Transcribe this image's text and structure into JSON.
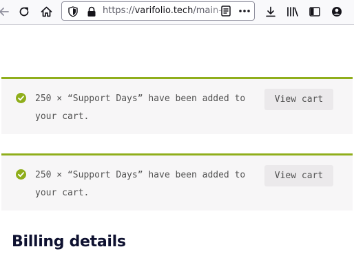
{
  "browser": {
    "url_scheme": "https://",
    "url_host": "varifolio.tech",
    "url_path": "/main-"
  },
  "notices": [
    {
      "message": "250 × “Support Days” have been added to your cart.",
      "button_label": "View cart"
    },
    {
      "message": "250 × “Support Days” have been added to your cart.",
      "button_label": "View cart"
    }
  ],
  "billing": {
    "title": "Billing details"
  },
  "colors": {
    "success_accent": "#8fae1b",
    "notice_background": "#f7f6f7",
    "heading": "#0e1130"
  },
  "icons": [
    "back-arrow-icon",
    "reload-icon",
    "home-icon",
    "shield-icon",
    "lock-icon",
    "reader-view-icon",
    "more-icon",
    "download-icon",
    "library-icon",
    "sidebar-icon",
    "account-icon",
    "check-circle-icon"
  ]
}
